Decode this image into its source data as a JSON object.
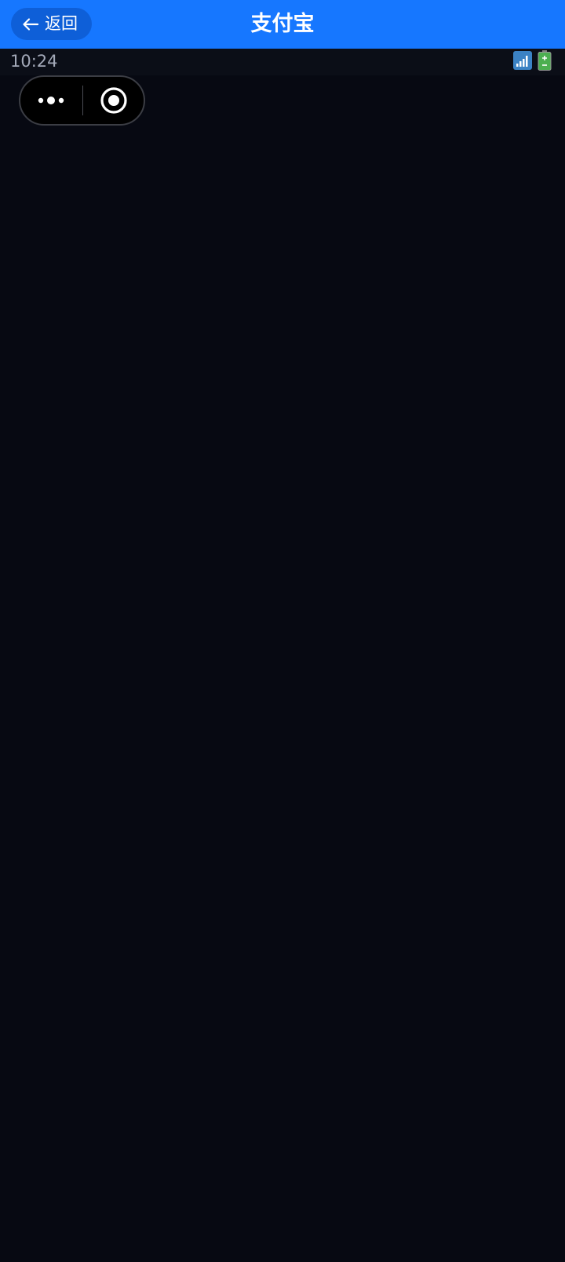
{
  "header": {
    "back_label": "返回",
    "title": "支付宝",
    "background_color": "#1677ff",
    "back_button_color": "#0e5fd8"
  },
  "status_bar": {
    "time": "10:24",
    "icons": [
      "signal-icon",
      "battery-icon"
    ]
  },
  "capsule": {
    "icons": [
      "more-icon",
      "close-target-icon"
    ]
  },
  "page": {
    "background_color": "#070912"
  }
}
